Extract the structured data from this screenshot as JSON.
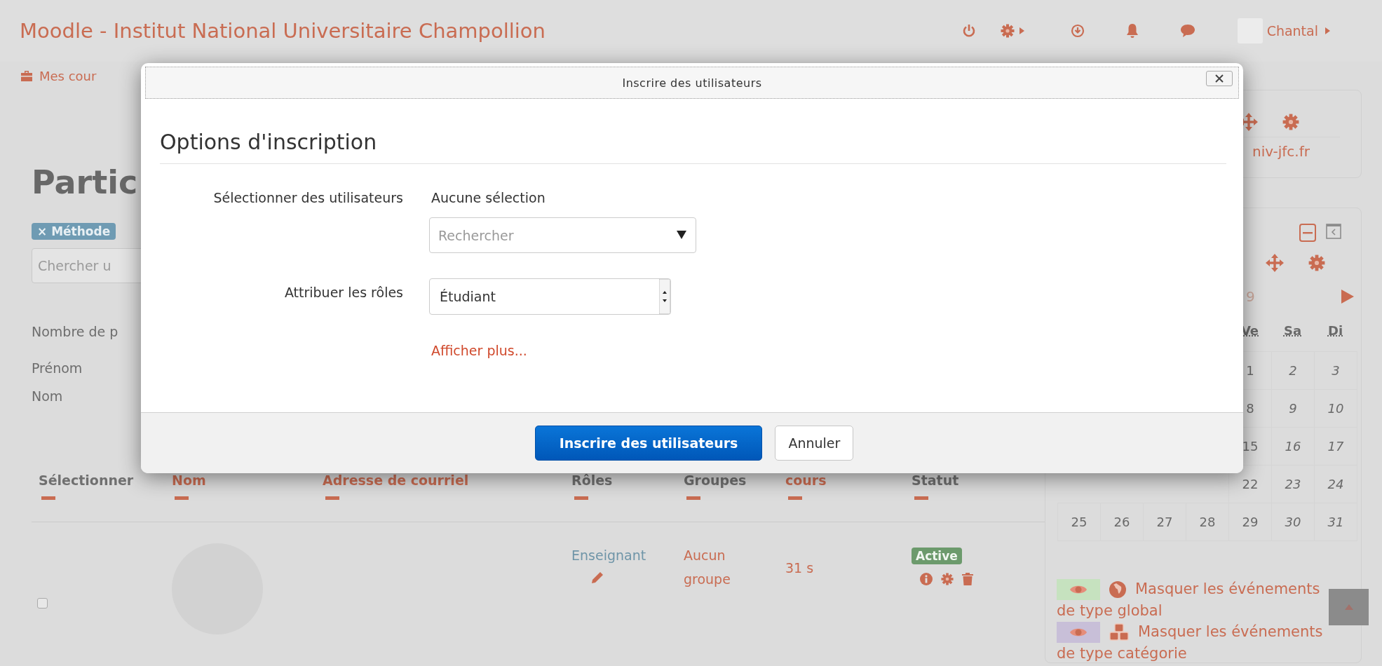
{
  "header": {
    "site_title": "Moodle - Institut National Universitaire Champollion",
    "user_name": "Chantal"
  },
  "nav": {
    "items": [
      {
        "label": "Mes cour"
      }
    ]
  },
  "participants": {
    "heading": "Partic",
    "filter_badge": "× Méthode",
    "search": {
      "placeholder": "Chercher u"
    },
    "count_label": "Nombre de p",
    "initial_filters": [
      "Prénom",
      "Nom"
    ]
  },
  "table": {
    "columns": [
      {
        "label": "Sélectionner",
        "sortable": false
      },
      {
        "label": "Nom",
        "sortable": true
      },
      {
        "label": "Adresse de courriel",
        "sortable": true
      },
      {
        "label": "Rôles",
        "sortable": false
      },
      {
        "label": "Groupes",
        "sortable": false
      },
      {
        "label": "cours",
        "sortable": true
      },
      {
        "label": "Statut",
        "sortable": false
      }
    ],
    "rows": [
      {
        "checked": false,
        "role": "Enseignant",
        "groups": "Aucun groupe",
        "last_access": "31 s",
        "status": "Active"
      }
    ]
  },
  "sidebar": {
    "email_block": {
      "text": "niv-jfc.fr"
    },
    "calendar": {
      "month": "9",
      "weekdays": [
        "Ve",
        "Sa",
        "Di"
      ],
      "weeks": [
        [
          "1",
          "2",
          "3"
        ],
        [
          "8",
          "9",
          "10"
        ],
        [
          "15",
          "16",
          "17"
        ],
        [
          "22",
          "23",
          "24"
        ],
        [
          "25",
          "26",
          "27",
          "28",
          "29",
          "30",
          "31"
        ]
      ],
      "legend": [
        {
          "text": "Masquer les événements de type global",
          "color": "#c6e2bf",
          "kind": "global"
        },
        {
          "text": "Masquer les événements de type catégorie",
          "color": "#c8bfd8",
          "kind": "category"
        }
      ]
    }
  },
  "dialog": {
    "title": "Inscrire des utilisateurs",
    "heading": "Options d'inscription",
    "fields": [
      {
        "kind": "autocomplete",
        "label": "Sélectionner des utilisateurs",
        "selection": "Aucune sélection",
        "placeholder": "Rechercher"
      },
      {
        "kind": "select",
        "label": "Attribuer les rôles",
        "value": "Étudiant"
      }
    ],
    "more_link": "Afficher plus...",
    "buttons": [
      {
        "label": "Inscrire des utilisateurs",
        "primary": true
      },
      {
        "label": "Annuler",
        "primary": false
      }
    ]
  }
}
